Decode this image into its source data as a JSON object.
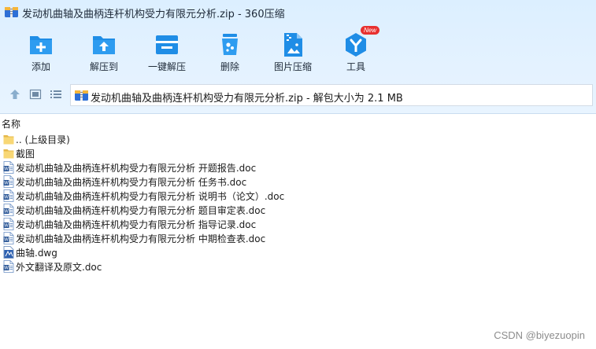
{
  "window": {
    "title": "发动机曲轴及曲柄连杆机构受力有限元分析.zip - 360压缩"
  },
  "toolbar": {
    "items": [
      {
        "label": "添加",
        "icon": "add-folder-icon"
      },
      {
        "label": "解压到",
        "icon": "extract-to-icon"
      },
      {
        "label": "一键解压",
        "icon": "one-click-extract-icon"
      },
      {
        "label": "删除",
        "icon": "delete-trash-icon"
      },
      {
        "label": "图片压缩",
        "icon": "image-compress-icon"
      },
      {
        "label": "工具",
        "icon": "tools-icon",
        "badge": "New"
      }
    ]
  },
  "address": {
    "text": "发动机曲轴及曲柄连杆机构受力有限元分析.zip - 解包大小为 2.1 MB"
  },
  "list": {
    "column_name": "名称",
    "items": [
      {
        "name": ".. (上级目录)",
        "icon": "folder-icon"
      },
      {
        "name": "截图",
        "icon": "folder-icon"
      },
      {
        "name": "发动机曲轴及曲柄连杆机构受力有限元分析 开题报告.doc",
        "icon": "word-doc-icon"
      },
      {
        "name": "发动机曲轴及曲柄连杆机构受力有限元分析 任务书.doc",
        "icon": "word-doc-icon"
      },
      {
        "name": "发动机曲轴及曲柄连杆机构受力有限元分析 说明书（论文）.doc",
        "icon": "word-doc-icon"
      },
      {
        "name": "发动机曲轴及曲柄连杆机构受力有限元分析 题目审定表.doc",
        "icon": "word-doc-icon"
      },
      {
        "name": "发动机曲轴及曲柄连杆机构受力有限元分析 指导记录.doc",
        "icon": "word-doc-icon"
      },
      {
        "name": "发动机曲轴及曲柄连杆机构受力有限元分析 中期检查表.doc",
        "icon": "word-doc-icon"
      },
      {
        "name": "曲轴.dwg",
        "icon": "dwg-file-icon"
      },
      {
        "name": "外文翻译及原文.doc",
        "icon": "word-doc-icon"
      }
    ]
  },
  "watermark": "CSDN @biyezuopin",
  "colors": {
    "accent": "#1a8fe3",
    "chrome": "#e4f2ff",
    "folder": "#f8d775",
    "badge": "#e8302f"
  }
}
